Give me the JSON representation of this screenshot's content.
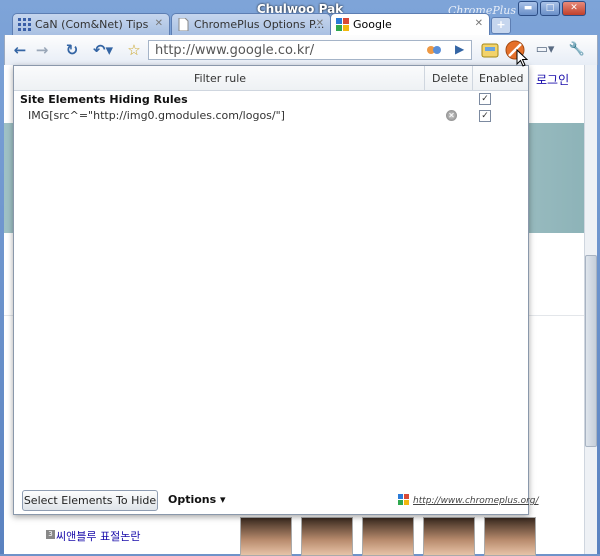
{
  "window": {
    "user_name": "Chulwoo Pak",
    "brand": "ChromePlus"
  },
  "tabs": [
    {
      "label": "CaN (Com&Net) Tips",
      "icon": "grid-icon"
    },
    {
      "label": "ChromePlus Options P...",
      "icon": "page-icon"
    },
    {
      "label": "Google",
      "icon": "google-icon"
    }
  ],
  "toolbar": {
    "url": "http://www.google.co.kr/"
  },
  "page": {
    "login_link": "로그인",
    "news": [
      "씨앤블루 표절논란"
    ]
  },
  "popup": {
    "col_filter": "Filter rule",
    "col_delete": "Delete",
    "col_enabled": "Enabled",
    "group_title": "Site Elements Hiding Rules",
    "rule": "IMG[src^=\"http://img0.gmodules.com/logos/\"]",
    "group_enabled": true,
    "rule_enabled": true,
    "select_button": "Select Elements To Hide",
    "options_label": "Options ▾",
    "site_link": "http://www.chromeplus.org/"
  },
  "colors": {
    "title_bar": "#6f93c9",
    "link": "#1a0dab"
  }
}
